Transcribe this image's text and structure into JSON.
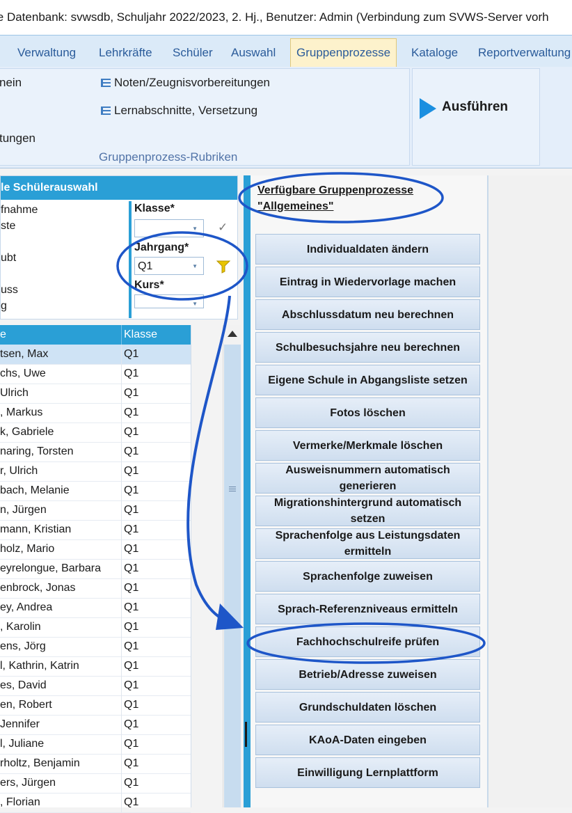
{
  "window": {
    "title": "le Datenbank: svwsdb, Schuljahr 2022/2023, 2. Hj., Benutzer: Admin (Verbindung zum SVWS-Server vorh"
  },
  "menu": [
    "Verwaltung",
    "Lehrkräfte",
    "Schüler",
    "Auswahl",
    "Gruppenprozesse",
    "Kataloge",
    "Reportverwaltung"
  ],
  "ribbon": {
    "left_items": [
      "nein",
      "tungen"
    ],
    "noten": "Noten/Zeugnisvorbereitungen",
    "lernabschnitte": "Lernabschnitte, Versetzung",
    "caption": "Gruppenprozess-Rubriken",
    "run": "Ausführen"
  },
  "selection": {
    "header": "le Schülerauswahl",
    "items": [
      "fnahme",
      "ste",
      "ubt",
      "uss",
      "g"
    ],
    "klasse_label": "Klasse*",
    "klasse_value": "",
    "jahrgang_label": "Jahrgang*",
    "jahrgang_value": "Q1",
    "kurs_label": "Kurs*"
  },
  "table": {
    "headers": [
      "e",
      "Klasse"
    ],
    "rows": [
      {
        "name": "tsen, Max",
        "klasse": "Q1"
      },
      {
        "name": "chs, Uwe",
        "klasse": "Q1"
      },
      {
        "name": " Ulrich",
        "klasse": "Q1"
      },
      {
        "name": ", Markus",
        "klasse": "Q1"
      },
      {
        "name": "k, Gabriele",
        "klasse": "Q1"
      },
      {
        "name": "naring, Torsten",
        "klasse": "Q1"
      },
      {
        "name": "r, Ulrich",
        "klasse": "Q1"
      },
      {
        "name": "bach, Melanie",
        "klasse": "Q1"
      },
      {
        "name": "n, Jürgen",
        "klasse": "Q1"
      },
      {
        "name": "mann, Kristian",
        "klasse": "Q1"
      },
      {
        "name": "holz, Mario",
        "klasse": "Q1"
      },
      {
        "name": "eyrelongue, Barbara",
        "klasse": "Q1"
      },
      {
        "name": "enbrock, Jonas",
        "klasse": "Q1"
      },
      {
        "name": "ey, Andrea",
        "klasse": "Q1"
      },
      {
        "name": ", Karolin",
        "klasse": "Q1"
      },
      {
        "name": "ens, Jörg",
        "klasse": "Q1"
      },
      {
        "name": "l, Kathrin, Katrin",
        "klasse": "Q1"
      },
      {
        "name": "es, David",
        "klasse": "Q1"
      },
      {
        "name": "en, Robert",
        "klasse": "Q1"
      },
      {
        "name": " Jennifer",
        "klasse": "Q1"
      },
      {
        "name": "l, Juliane",
        "klasse": "Q1"
      },
      {
        "name": "rholtz, Benjamin",
        "klasse": "Q1"
      },
      {
        "name": "ers, Jürgen",
        "klasse": "Q1"
      },
      {
        "name": ", Florian",
        "klasse": "Q1"
      }
    ]
  },
  "gruppenprozesse": {
    "heading_line1": "Verfügbare Gruppenprozesse",
    "heading_line2": "\"Allgemeines\"",
    "buttons": [
      "Individualdaten ändern",
      "Eintrag in Wiedervorlage machen",
      "Abschlussdatum neu berechnen",
      "Schulbesuchsjahre neu berechnen",
      "Eigene Schule in Abgangsliste setzen",
      "Fotos löschen",
      "Vermerke/Merkmale löschen",
      "Ausweisnummern automatisch generieren",
      "Migrationshintergrund automatisch setzen",
      "Sprachenfolge aus Leistungsdaten ermitteln",
      "Sprachenfolge zuweisen",
      "Sprach-Referenzniveaus ermitteln",
      "Fachhochschulreife prüfen",
      "Betrieb/Adresse zuweisen",
      "Grundschuldaten löschen",
      "KAoA-Daten eingeben",
      "Einwilligung Lernplattform"
    ]
  },
  "colors": {
    "accent": "#2a9fd6",
    "annotation": "#1e56c8"
  }
}
